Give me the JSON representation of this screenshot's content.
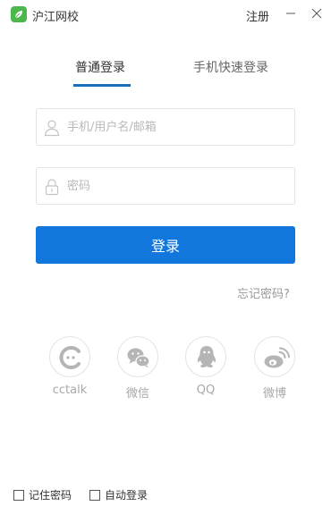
{
  "titlebar": {
    "app_title": "沪江网校",
    "register_label": "注册",
    "minimize_glyph": "—",
    "close_glyph": "✕",
    "logo_color": "#4cb84c"
  },
  "tabs": [
    {
      "label": "普通登录",
      "active": true
    },
    {
      "label": "手机快速登录",
      "active": false
    }
  ],
  "form": {
    "account_placeholder": "手机/用户名/邮箱",
    "account_value": "",
    "password_placeholder": "密码",
    "password_value": "",
    "login_label": "登录",
    "forgot_label": "忘记密码?"
  },
  "social": [
    {
      "label": "cctalk",
      "icon": "cctalk-icon"
    },
    {
      "label": "微信",
      "icon": "wechat-icon"
    },
    {
      "label": "QQ",
      "icon": "qq-icon"
    },
    {
      "label": "微博",
      "icon": "weibo-icon"
    }
  ],
  "options": {
    "remember_label": "记住密码",
    "remember_checked": false,
    "auto_login_label": "自动登录",
    "auto_login_checked": false
  },
  "colors": {
    "accent": "#1277dc",
    "tab_underline": "#1a6fb8",
    "muted_text": "#a8a8a8"
  }
}
